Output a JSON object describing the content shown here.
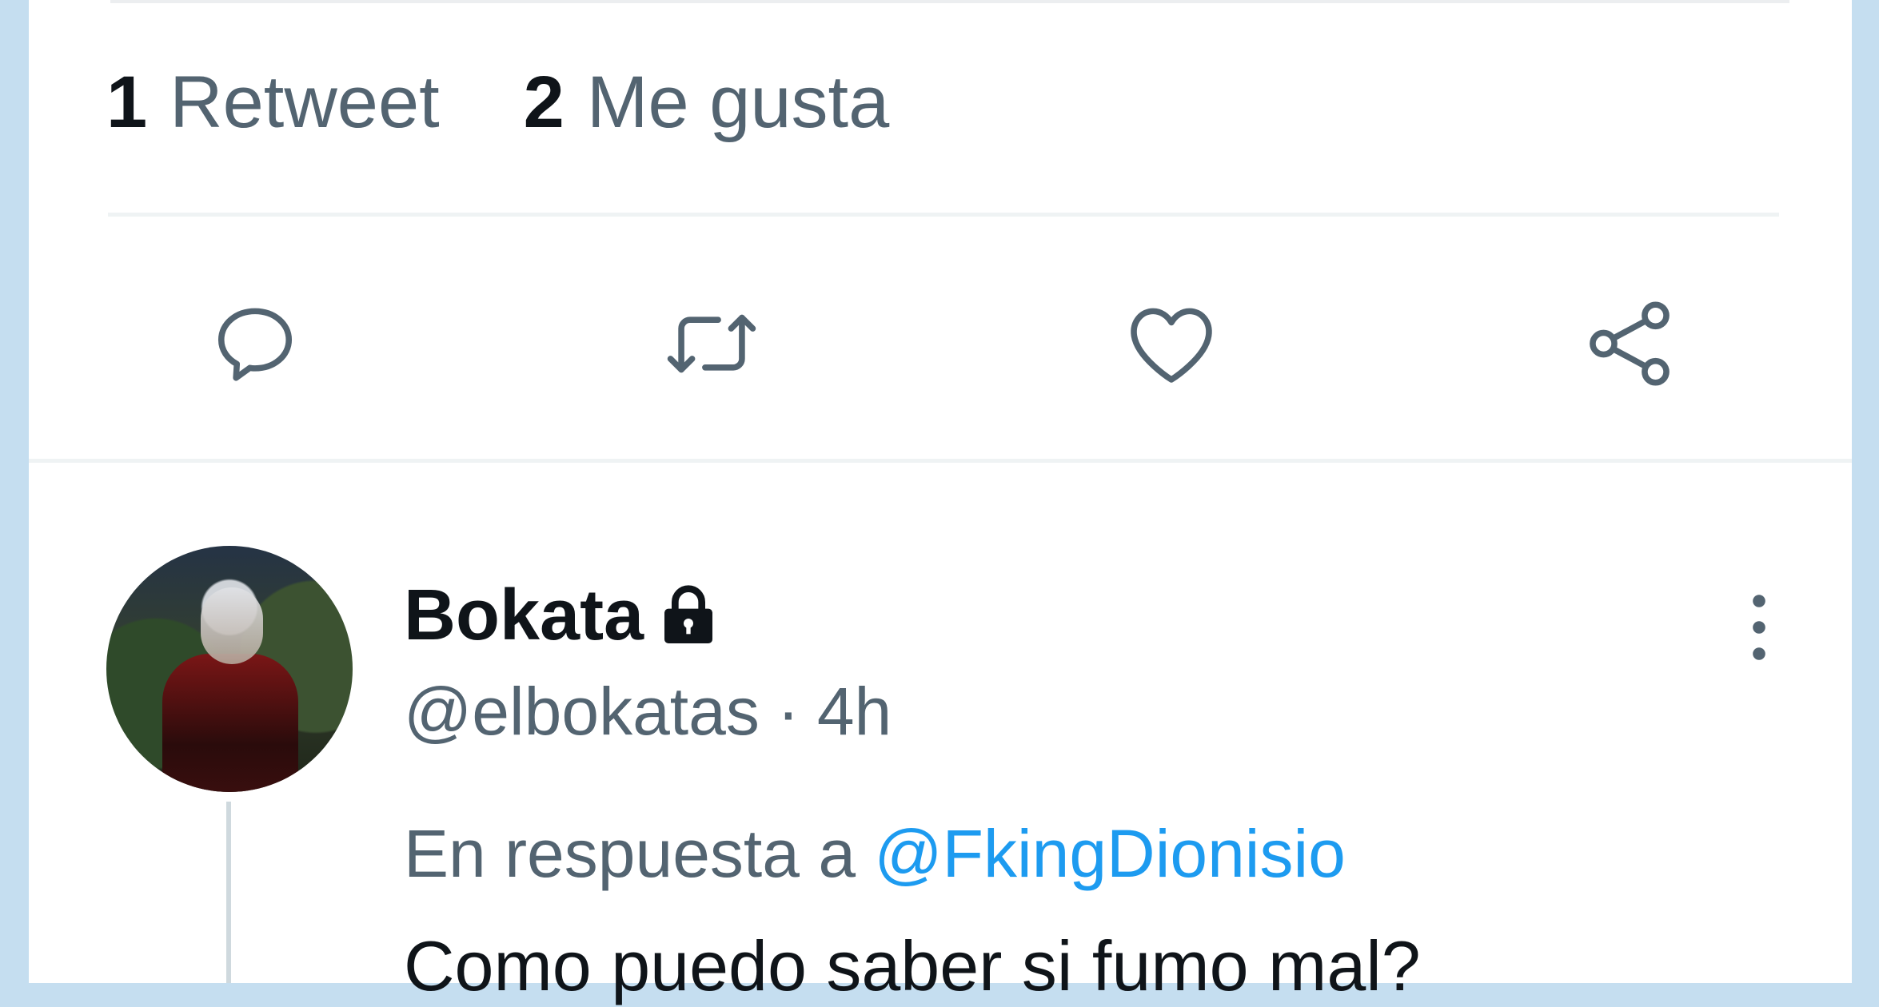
{
  "stats": {
    "retweets": {
      "count": "1",
      "label": "Retweet"
    },
    "likes": {
      "count": "2",
      "label": "Me gusta"
    }
  },
  "actions": [
    {
      "icon": "reply-icon"
    },
    {
      "icon": "retweet-icon"
    },
    {
      "icon": "like-icon"
    },
    {
      "icon": "share-icon"
    }
  ],
  "reply": {
    "display_name": "Bokata",
    "handle": "@elbokatas",
    "separator": "·",
    "time": "4h",
    "reply_prefix": "En respuesta a",
    "mention": "@FkingDionisio",
    "text": "Como puedo saber si fumo mal?"
  },
  "colors": {
    "accent": "#1d9bf0",
    "text": "#0f1419",
    "muted": "#536471",
    "icon": "#536471"
  }
}
